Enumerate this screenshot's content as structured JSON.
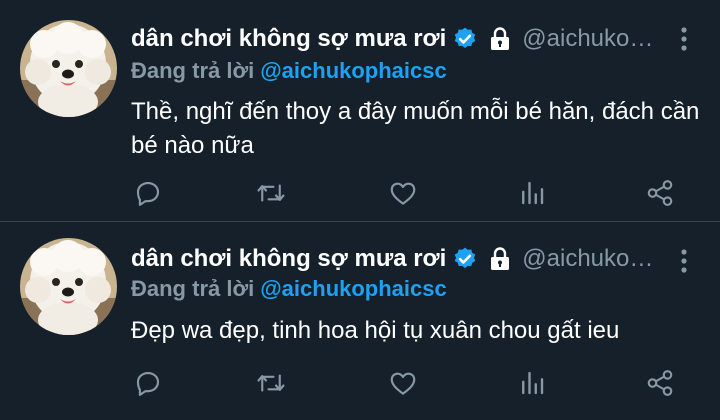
{
  "tweets": [
    {
      "display_name": "dân chơi không sợ mưa rơi",
      "handle": "@aichuko…",
      "reply_prefix": "Đang trả lời",
      "reply_to": "@aichukophaicsc",
      "text": "Thề, nghĩ đến thoy a đây muốn mỗi bé hăn, đách cần bé nào nữa",
      "avatar_icon": "white-dog-avatar",
      "verified_icon": "verified-badge-icon",
      "protected_icon": "lock-icon"
    },
    {
      "display_name": "dân chơi không sợ mưa rơi",
      "handle": "@aichuko…",
      "reply_prefix": "Đang trả lời",
      "reply_to": "@aichukophaicsc",
      "text": "Đẹp wa đẹp, tinh hoa hội tụ xuân chou gất ieu",
      "avatar_icon": "white-dog-avatar",
      "verified_icon": "verified-badge-icon",
      "protected_icon": "lock-icon"
    }
  ],
  "actions": [
    "reply-icon",
    "retweet-icon",
    "like-icon",
    "analytics-icon",
    "share-icon"
  ],
  "colors": {
    "background": "#15202b",
    "divider": "#38444d",
    "text_primary": "#ffffff",
    "text_secondary": "#8899a6",
    "accent": "#1da1f2"
  }
}
